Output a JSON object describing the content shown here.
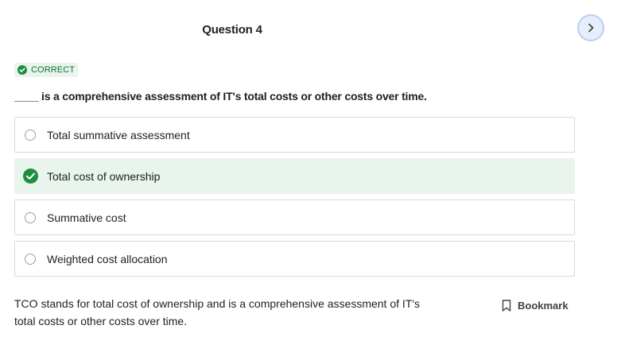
{
  "header": {
    "question_title": "Question 4",
    "next_icon": "chevron-right-icon"
  },
  "status": {
    "badge_label": "CORRECT",
    "badge_icon": "check-circle-icon",
    "color": "#137333"
  },
  "question": {
    "prompt": "____ is a comprehensive assessment of IT's total costs or other costs over time."
  },
  "options": [
    {
      "label": "Total summative assessment",
      "selected": false
    },
    {
      "label": "Total cost of ownership",
      "selected": true
    },
    {
      "label": "Summative cost",
      "selected": false
    },
    {
      "label": "Weighted cost allocation",
      "selected": false
    }
  ],
  "feedback": {
    "explanation": "TCO stands for total cost of ownership and is a comprehensive assessment of IT's total costs or other costs over time."
  },
  "actions": {
    "bookmark_label": "Bookmark",
    "bookmark_icon": "bookmark-icon"
  },
  "colors": {
    "correct_bg": "#e8f4ec",
    "correct_accent": "#1e8e3e",
    "next_button_bg": "#e6eefc"
  }
}
